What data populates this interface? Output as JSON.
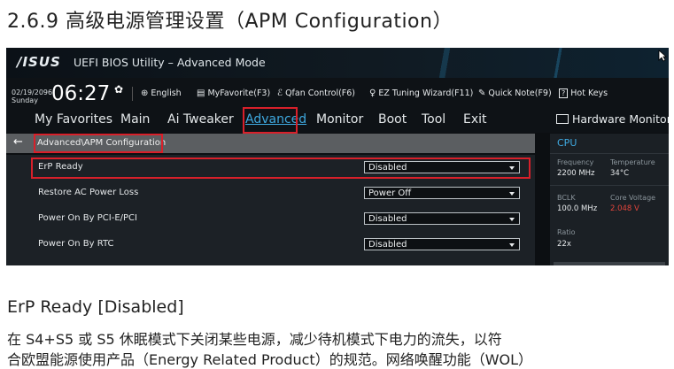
{
  "doc": {
    "heading": "2.6.9 高级电源管理设置（APM Configuration）",
    "section_title": "ErP Ready [Disabled]",
    "paragraph_line1": "在 S4+S5 或 S5 休眠模式下关闭某些电源，减少待机模式下电力的流失，以符",
    "paragraph_line2": "合欧盟能源使用产品（Energy Related Product）的规范。网络唤醒功能（WOL）"
  },
  "bios": {
    "logo": "/ISUS",
    "title": "UEFI BIOS Utility – Advanced Mode",
    "date": "02/19/2096",
    "day": "Sunday",
    "time": "06:27",
    "tools": [
      {
        "icon": "globe-icon",
        "label": "English"
      },
      {
        "icon": "star-folder-icon",
        "label": "MyFavorite(F3)"
      },
      {
        "icon": "fan-icon",
        "label": "Qfan Control(F6)"
      },
      {
        "icon": "bulb-icon",
        "label": "EZ Tuning Wizard(F11)"
      },
      {
        "icon": "note-icon",
        "label": "Quick Note(F9)"
      },
      {
        "icon": "help-icon",
        "label": "Hot Keys"
      }
    ],
    "menu": [
      "My Favorites",
      "Main",
      "Ai Tweaker",
      "Advanced",
      "Monitor",
      "Boot",
      "Tool",
      "Exit"
    ],
    "active_menu": "Advanced",
    "breadcrumb": "Advanced\\APM Configuration",
    "settings": [
      {
        "label": "ErP Ready",
        "value": "Disabled"
      },
      {
        "label": "Restore AC Power Loss",
        "value": "Power Off"
      },
      {
        "label": "Power On By PCI-E/PCI",
        "value": "Disabled"
      },
      {
        "label": "Power On By RTC",
        "value": "Disabled"
      }
    ],
    "hardware_monitor": {
      "title": "Hardware Monitor",
      "category": "CPU",
      "frequency_label": "Frequency",
      "frequency_value": "2200 MHz",
      "temperature_label": "Temperature",
      "temperature_value": "34°C",
      "bclk_label": "BCLK",
      "bclk_value": "100.0 MHz",
      "core_voltage_label": "Core Voltage",
      "core_voltage_value": "2.048 V",
      "ratio_label": "Ratio",
      "ratio_value": "22x"
    }
  },
  "colors": {
    "accent": "#3fa9e0",
    "highlight_box": "#d8202a",
    "alert_value": "#e2443b"
  }
}
